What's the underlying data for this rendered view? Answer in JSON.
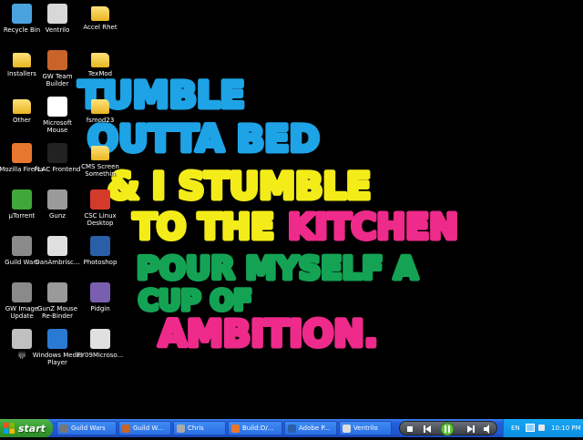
{
  "desktop_icons": [
    {
      "label": "Recycle Bin",
      "icon": "recycle-bin-icon",
      "color": "#4aa3df"
    },
    {
      "label": "Ventrilo",
      "icon": "ventrilo-icon",
      "color": "#d8d8d8"
    },
    {
      "label": "Accel Rhet",
      "icon": "folder-icon",
      "color": "#f0c040"
    },
    {
      "label": "Installers",
      "icon": "folder-icon",
      "color": "#f0c040"
    },
    {
      "label": "GW Team\nBuilder",
      "icon": "gw-team-builder-icon",
      "color": "#c8642a"
    },
    {
      "label": "TexMod",
      "icon": "folder-icon",
      "color": "#f0c040"
    },
    {
      "label": "Other",
      "icon": "folder-icon",
      "color": "#f0c040"
    },
    {
      "label": "Microsoft\nMouse",
      "icon": "mouse-icon",
      "color": "#ffffff"
    },
    {
      "label": "fsmod23",
      "icon": "folder-icon",
      "color": "#f0c040"
    },
    {
      "label": "Mozilla Firefox",
      "icon": "firefox-icon",
      "color": "#e8772e"
    },
    {
      "label": "FLAC Frontend",
      "icon": "flac-icon",
      "color": "#222222"
    },
    {
      "label": "CMS Screen\nSomethin",
      "icon": "folder-icon",
      "color": "#f0c040"
    },
    {
      "label": "µTorrent",
      "icon": "utorrent-icon",
      "color": "#3fa83a"
    },
    {
      "label": "Gunz",
      "icon": "gunz-icon",
      "color": "#9a9a9a"
    },
    {
      "label": "CSC Linux\nDesktop",
      "icon": "csc-icon",
      "color": "#d43a2a"
    },
    {
      "label": "Guild Wars",
      "icon": "guild-wars-icon",
      "color": "#8a8a8a"
    },
    {
      "label": "DanAmbrisc...",
      "icon": "document-icon",
      "color": "#e0e0e0"
    },
    {
      "label": "Photoshop",
      "icon": "photoshop-icon",
      "color": "#2a5fa8"
    },
    {
      "label": "GW Image\nUpdate",
      "icon": "gw-update-icon",
      "color": "#8a8a8a"
    },
    {
      "label": "GunZ Mouse\nRe-Binder",
      "icon": "gunz-binder-icon",
      "color": "#9a9a9a"
    },
    {
      "label": "Pidgin",
      "icon": "pidgin-icon",
      "color": "#7a5fb0"
    },
    {
      "label": "ijji",
      "icon": "ijji-icon",
      "color": "#c0c0c0"
    },
    {
      "label": "Windows Media\nPlayer",
      "icon": "media-player-icon",
      "color": "#2a7ad4"
    },
    {
      "label": "FY09Microso...",
      "icon": "document-icon",
      "color": "#e0e0e0"
    }
  ],
  "wallpaper": {
    "lines": [
      {
        "text": "TUMBLE",
        "color": "#1ea3e6"
      },
      {
        "text": "OUTTA BED",
        "color": "#1ea3e6"
      },
      {
        "text": "& I STUMBLE",
        "color": "#f3ec19"
      },
      {
        "text": "TO THE",
        "color": "#f3ec19"
      },
      {
        "text": "KITCHEN",
        "color": "#ee2a8a"
      },
      {
        "text": "POUR MYSELF A",
        "color": "#14a354"
      },
      {
        "text": "CUP OF",
        "color": "#14a354"
      },
      {
        "text": "AMBITION.",
        "color": "#ee2a8a"
      }
    ]
  },
  "taskbar": {
    "start_label": "start",
    "tasks": [
      {
        "label": "Guild Wars",
        "icon": "guild-wars-icon",
        "color": "#777"
      },
      {
        "label": "Guild W...",
        "icon": "gw-team-builder-icon",
        "color": "#c8642a"
      },
      {
        "label": "Chris",
        "icon": "chat-icon",
        "color": "#aaa"
      },
      {
        "label": "Build:D/...",
        "icon": "firefox-icon",
        "color": "#e8772e"
      },
      {
        "label": "Adobe P...",
        "icon": "photoshop-icon",
        "color": "#2a5fa8"
      },
      {
        "label": "Ventrilo",
        "icon": "ventrilo-icon",
        "color": "#ddd"
      }
    ],
    "tray": {
      "language": "EN",
      "clock": "10:10 PM"
    }
  }
}
